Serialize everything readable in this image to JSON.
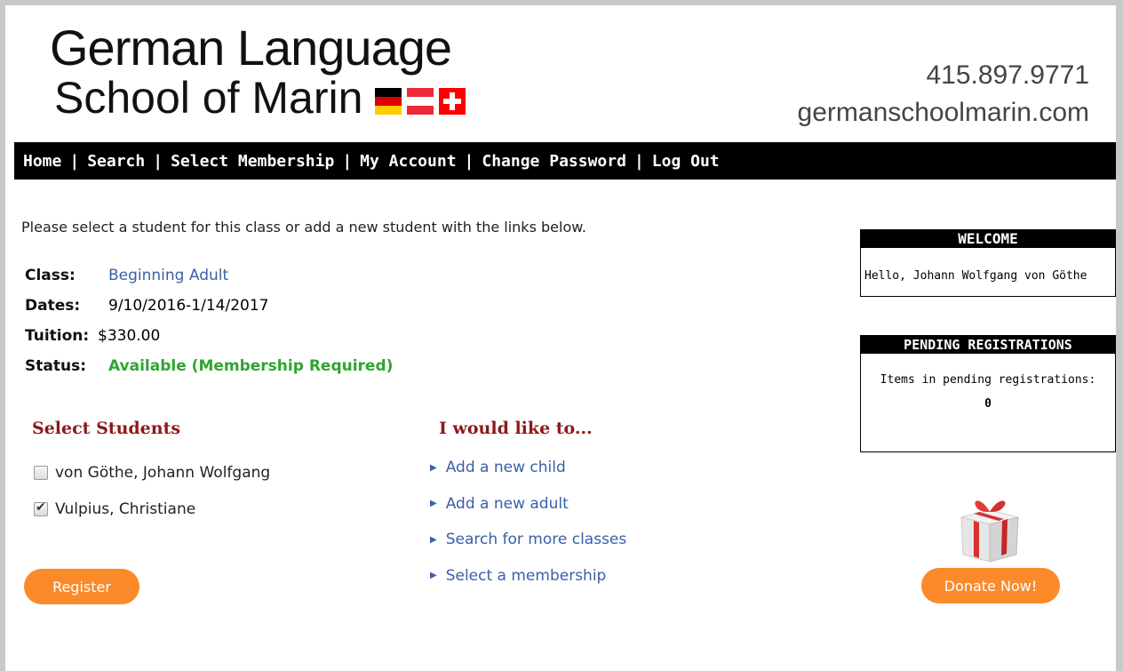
{
  "header": {
    "logo_line1": "German Language",
    "logo_line2": "School of Marin",
    "phone": "415.897.9771",
    "website": "germanschoolmarin.com"
  },
  "nav": {
    "items": [
      "Home",
      "Search",
      "Select Membership",
      "My Account",
      "Change Password",
      "Log Out"
    ],
    "separator": "|"
  },
  "main": {
    "intro": "Please select a student for this class or add a new student with the links below.",
    "class_label": "Class:",
    "class_value": "Beginning Adult",
    "dates_label": "Dates:",
    "dates_value": "9/10/2016-1/14/2017",
    "tuition_label": "Tuition:",
    "tuition_value": "$330.00",
    "status_label": "Status:",
    "status_value": "Available (Membership Required)",
    "select_students_title": "Select Students",
    "students": [
      {
        "name": "von Göthe, Johann Wolfgang",
        "checked": false
      },
      {
        "name": "Vulpius, Christiane",
        "checked": true
      }
    ],
    "register_label": "Register",
    "actions_title": "I would like to...",
    "actions": [
      "Add a new child",
      "Add a new adult",
      "Search for more classes",
      "Select a membership"
    ]
  },
  "sidebar": {
    "welcome_title": "WELCOME",
    "welcome_text": "Hello, Johann Wolfgang von Göthe",
    "pending_title": "PENDING REGISTRATIONS",
    "pending_text": "Items in pending registrations:",
    "pending_count": "0",
    "donate_label": "Donate Now!"
  },
  "colors": {
    "accent_orange": "#fb8a2a",
    "link_blue": "#3a60a8",
    "status_green": "#2ea62e",
    "section_red": "#8b1a1a"
  }
}
